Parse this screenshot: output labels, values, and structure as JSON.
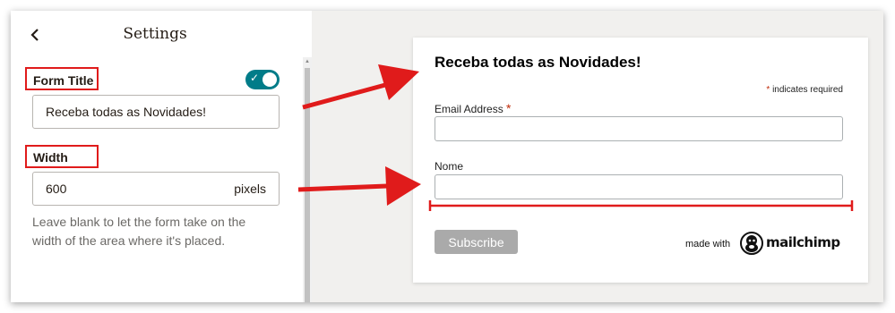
{
  "settings": {
    "back_icon": "chevron-left-icon",
    "title": "Settings",
    "form_title_label": "Form Title",
    "form_title_toggle_on": true,
    "form_title_value": "Receba todas as Novidades!",
    "width_label": "Width",
    "width_value": "600",
    "width_suffix": "pixels",
    "width_help": "Leave blank to let the form take on the width of the area where it's placed."
  },
  "preview": {
    "title": "Receba todas as Novidades!",
    "required_mark": "*",
    "required_note": "indicates required",
    "email_label": "Email Address",
    "email_required_mark": "*",
    "nome_label": "Nome",
    "subscribe_label": "Subscribe",
    "made_with": "made with",
    "brand": "mailchimp"
  },
  "colors": {
    "accent": "#007c89",
    "annotation_red": "#e01b1b",
    "subscribe_disabled": "#aaaaaa"
  }
}
